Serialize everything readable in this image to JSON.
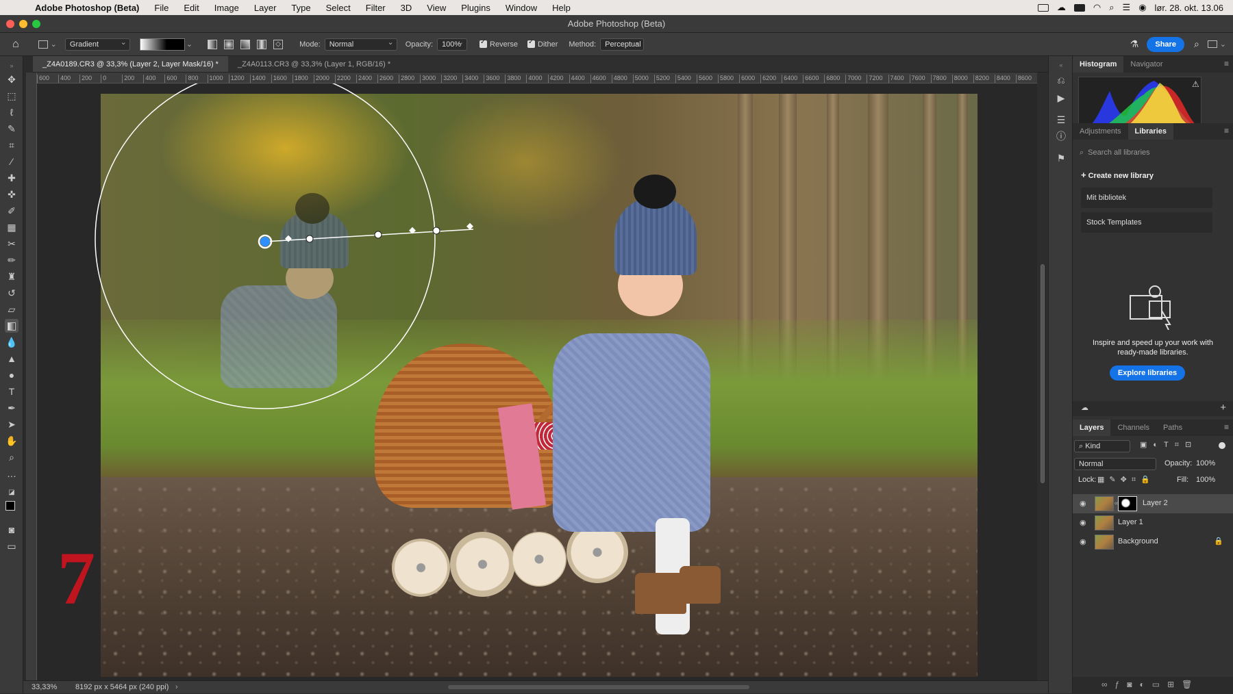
{
  "menubar": {
    "app_name": "Adobe Photoshop (Beta)",
    "items": [
      "File",
      "Edit",
      "Image",
      "Layer",
      "Type",
      "Select",
      "Filter",
      "3D",
      "View",
      "Plugins",
      "Window",
      "Help"
    ],
    "clock": "lør. 28. okt.  13.06"
  },
  "window": {
    "title": "Adobe Photoshop (Beta)"
  },
  "options": {
    "tool_preset": "Gradient",
    "mode_label": "Mode:",
    "mode_value": "Normal",
    "opacity_label": "Opacity:",
    "opacity_value": "100%",
    "reverse_label": "Reverse",
    "dither_label": "Dither",
    "method_label": "Method:",
    "method_value": "Perceptual",
    "share_label": "Share"
  },
  "tabs": [
    {
      "label": "_Z4A0189.CR3 @ 33,3% (Layer 2, Layer Mask/16) *",
      "active": true
    },
    {
      "label": "_Z4A0113.CR3 @ 33,3% (Layer 1, RGB/16) *",
      "active": false
    }
  ],
  "ruler_marks": [
    "600",
    "400",
    "200",
    "0",
    "200",
    "400",
    "600",
    "800",
    "1000",
    "1200",
    "1400",
    "1600",
    "1800",
    "2000",
    "2200",
    "2400",
    "2600",
    "2800",
    "3000",
    "3200",
    "3400",
    "3600",
    "3800",
    "4000",
    "4200",
    "4400",
    "4600",
    "4800",
    "5000",
    "5200",
    "5400",
    "5600",
    "5800",
    "6000",
    "6200",
    "6400",
    "6600",
    "6800",
    "7000",
    "7200",
    "7400",
    "7600",
    "7800",
    "8000",
    "8200",
    "8400",
    "8600"
  ],
  "status": {
    "zoom": "33,33%",
    "doc_info": "8192 px x 5464 px (240 ppi)"
  },
  "annotation_mark": "7",
  "panels": {
    "top_tabs": [
      "Histogram",
      "Navigator"
    ],
    "mid_tabs": [
      "Adjustments",
      "Libraries"
    ],
    "search_placeholder": "Search all libraries",
    "create_library": "Create new library",
    "libraries": [
      "Mit bibliotek",
      "Stock Templates"
    ],
    "promo_text": "Inspire and speed up your work with ready-made libraries.",
    "explore_button": "Explore libraries",
    "layer_tabs": [
      "Layers",
      "Channels",
      "Paths"
    ],
    "kind_filter": "Kind",
    "blend_mode": "Normal",
    "opacity_label": "Opacity:",
    "opacity_value": "100%",
    "lock_label": "Lock:",
    "fill_label": "Fill:",
    "fill_value": "100%",
    "layers": [
      {
        "name": "Layer 2",
        "selected": true,
        "has_mask": true
      },
      {
        "name": "Layer 1",
        "selected": false,
        "has_mask": false
      },
      {
        "name": "Background",
        "selected": false,
        "has_mask": false,
        "locked": true
      }
    ]
  },
  "icons": {
    "tools": [
      "move-icon",
      "marquee-icon",
      "lasso-icon",
      "quick-select-icon",
      "crop-icon",
      "eyedropper-icon",
      "healing-icon",
      "spot-heal-icon",
      "brush-icon",
      "frame-icon",
      "content-aware-icon",
      "paint-brush-icon",
      "clone-stamp-icon",
      "history-brush-icon",
      "eraser-icon",
      "gradient-icon",
      "blur-icon",
      "sharpen-icon",
      "dodge-icon",
      "type-icon",
      "pen-icon",
      "path-select-icon",
      "hand-icon",
      "zoom-icon",
      "more-tools-icon"
    ]
  },
  "colors": {
    "accent": "#1473e6",
    "panel_bg": "#323232",
    "canvas_bg": "#282828",
    "annotation": "#c0141e"
  }
}
